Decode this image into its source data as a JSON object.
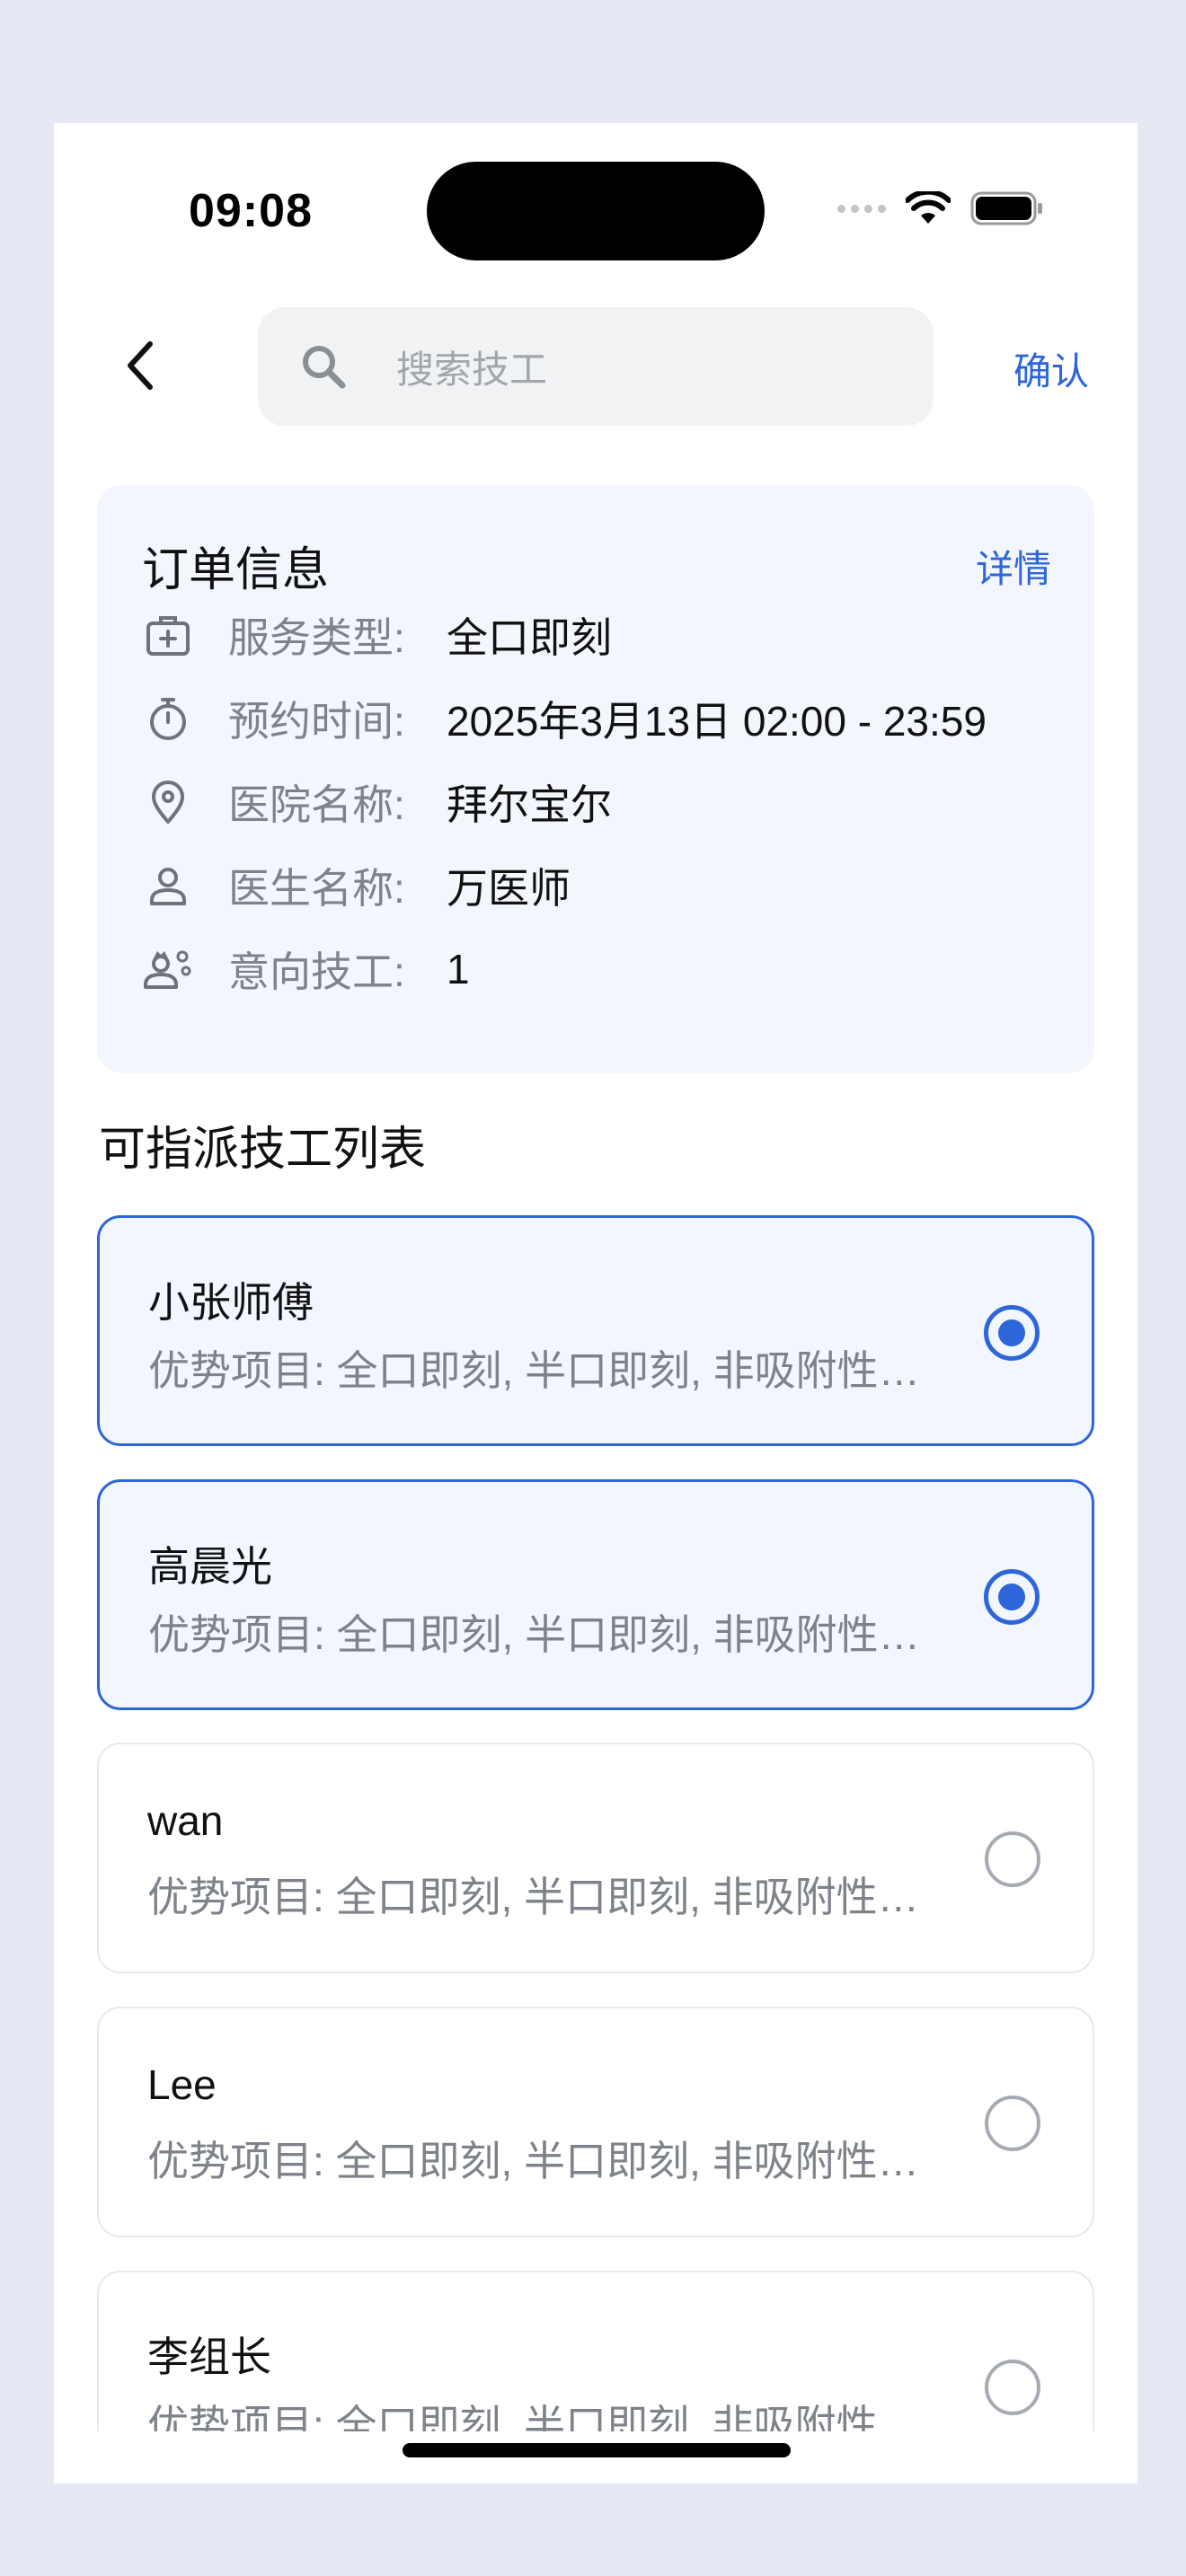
{
  "status_bar": {
    "time": "09:08"
  },
  "header": {
    "search_placeholder": "搜索技工",
    "confirm_label": "确认"
  },
  "order": {
    "title": "订单信息",
    "detail_label": "详情",
    "rows": [
      {
        "icon": "medical-kit-icon",
        "label": "服务类型:",
        "value": "全口即刻"
      },
      {
        "icon": "stopwatch-icon",
        "label": "预约时间:",
        "value": "2025年3月13日 02:00 - 23:59"
      },
      {
        "icon": "location-pin-icon",
        "label": "医院名称:",
        "value": "拜尔宝尔"
      },
      {
        "icon": "person-icon",
        "label": "医生名称:",
        "value": "万医师"
      },
      {
        "icon": "technician-icon",
        "label": "意向技工:",
        "value": "1"
      }
    ]
  },
  "technicians": {
    "title": "可指派技工列表",
    "items": [
      {
        "name": "小张师傅",
        "skills": "优势项目: 全口即刻, 半口即刻, 非吸附性义齿",
        "selected": true
      },
      {
        "name": "高晨光",
        "skills": "优势项目: 全口即刻, 半口即刻, 非吸附性义齿",
        "selected": true
      },
      {
        "name": "wan",
        "skills": "优势项目: 全口即刻, 半口即刻, 非吸附性义齿",
        "selected": false
      },
      {
        "name": "Lee",
        "skills": "优势项目: 全口即刻, 半口即刻, 非吸附性义齿",
        "selected": false
      },
      {
        "name": "李组长",
        "skills": "优势项目: 全口即刻, 半口即刻, 非吸附性义齿",
        "selected": false
      }
    ]
  },
  "colors": {
    "accent": "#2d66d9",
    "card_bg": "#f3f6fd",
    "page_bg": "#e6e9f3"
  }
}
